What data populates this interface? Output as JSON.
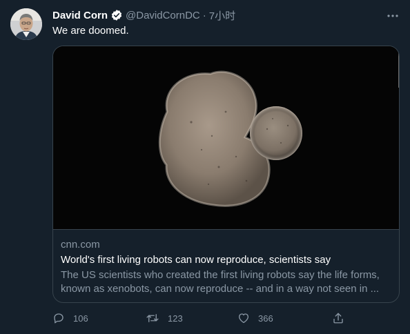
{
  "tweet": {
    "author_name": "David Corn",
    "handle": "@DavidCornDC",
    "separator": "·",
    "time": "7小时",
    "text": "We are doomed."
  },
  "card": {
    "domain": "cnn.com",
    "title": "World's first living robots can now reproduce, scientists say",
    "description": "The US scientists who created the first living robots say the life forms, known as xenobots, can now reproduce -- and in a way not seen in ..."
  },
  "actions": {
    "reply_count": "106",
    "retweet_count": "123",
    "like_count": "366"
  },
  "icons": {
    "verified": "verified-badge-icon",
    "more": "more-horizontal-icon",
    "reply": "reply-icon",
    "retweet": "retweet-icon",
    "like": "heart-icon",
    "share": "share-icon"
  },
  "colors": {
    "background": "#15202b",
    "secondary_text": "#8b98a5",
    "border": "#38444d"
  }
}
